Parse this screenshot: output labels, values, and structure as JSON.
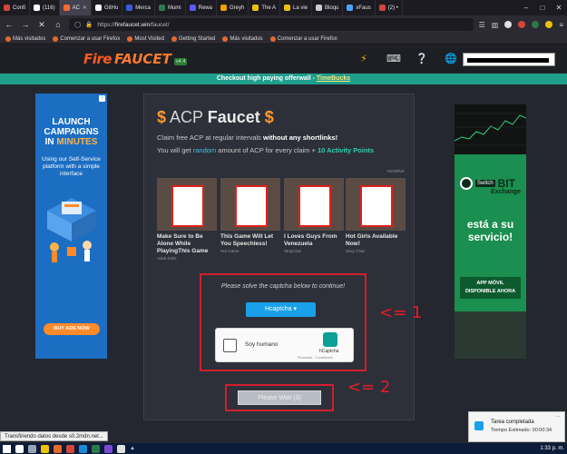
{
  "browser": {
    "tabs": [
      {
        "label": "Confi",
        "color": "#d44638"
      },
      {
        "label": "(116)",
        "color": "#ffffff"
      },
      {
        "label": "AC",
        "color": "#ff6a2c",
        "active": true
      },
      {
        "label": "GitHu",
        "color": "#ffffff"
      },
      {
        "label": "Merca",
        "color": "#3b5bdb"
      },
      {
        "label": "Mumi",
        "color": "#2b7a4b"
      },
      {
        "label": "Rewa",
        "color": "#5a5aff"
      },
      {
        "label": "Greyh",
        "color": "#f0a000"
      },
      {
        "label": "The A",
        "color": "#f0c000"
      },
      {
        "label": "La vie",
        "color": "#f0c000"
      },
      {
        "label": "Bloqu",
        "color": "#cccccc"
      },
      {
        "label": "xFaus",
        "color": "#4ba3ff"
      },
      {
        "label": "(2) •",
        "color": "#d44638"
      }
    ],
    "url_prefix": "https://",
    "url_host": "firefaucet.win",
    "url_path": "/faucet/",
    "bookmarks": [
      "Más visitados",
      "Comenzar a usar Firefox",
      "Most Visited",
      "Getting Started",
      "Más visitados",
      "Comenzar a usar Firefox"
    ]
  },
  "site": {
    "logo_fire": "Fire",
    "logo_faucet": "FAUCET",
    "logo_version": "v4.4",
    "announcement_prefix": "Checkout high paying offerwall - ",
    "announcement_link": "TimeBucks"
  },
  "left_ad": {
    "line1": "LAUNCH",
    "line2": "CAMPAIGNS",
    "line3_pre": "IN ",
    "line3_hl": "MINUTES",
    "body": "Using our Self-Service platform with a simple interface",
    "cta": "BUY ADS NOW"
  },
  "right_ad": {
    "brand_switch": "Switch",
    "brand_bit": "BIT",
    "brand_exchange": "Exchange",
    "slogan": "está a su servicio!",
    "cta_line1": "APP MÓVIL",
    "cta_line2": "DISPONIBLE AHORA"
  },
  "faucet": {
    "title_currency": "ACP",
    "title_word": "Faucet",
    "dollar": "$",
    "claim_text": "Claim free ACP at regular intervals ",
    "claim_bold": "without any shortlinks!",
    "random_pre": "You will get ",
    "random_word": "random",
    "random_mid": " amount of ACP for every claim + ",
    "points": "10 Activity Points",
    "native_label": "runative",
    "native_ads": [
      {
        "title": "Make Sure to Be Alone While PlayingThis Game",
        "source": "Adult Dolls"
      },
      {
        "title": "This Game Will Let You Speechless!",
        "source": "Hot Game"
      },
      {
        "title": "I Loves Guys From Venezuela",
        "source": "StripChat"
      },
      {
        "title": "Hot Girls Available Now!",
        "source": "Sexy Chat"
      }
    ],
    "captcha_prompt": "Please solve the captcha below to continue!",
    "captcha_select": "Hcaptcha",
    "hcaptcha_label": "Soy humano",
    "hcaptcha_brand": "hCaptcha",
    "hcaptcha_terms": "Privacidad - Condiciones",
    "wait_button": "Please Wait (3)"
  },
  "annotations": {
    "arrow1": "<= 1",
    "arrow2": "<= 2"
  },
  "status": {
    "loading_text": "Transfiriendo datos desde s0.2mdn.net..."
  },
  "notification": {
    "title": "Tarea completada",
    "detail": "Tiempo Estimado: 00:00:34"
  },
  "taskbar": {
    "time": "1:33 p. m."
  }
}
